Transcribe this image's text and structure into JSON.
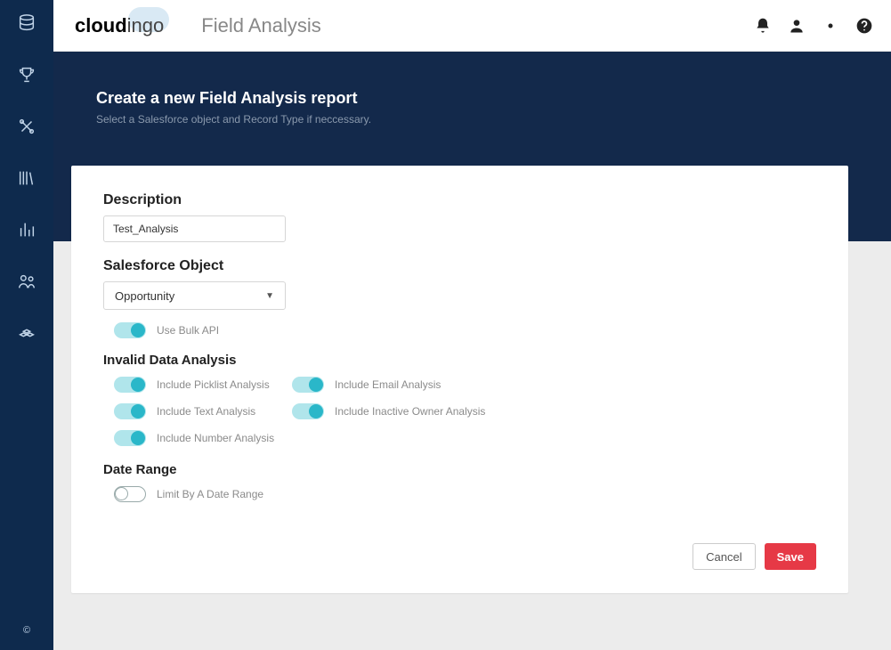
{
  "brand": {
    "part1": "cloud",
    "part2": "ingo"
  },
  "page_title": "Field Analysis",
  "copyright_symbol": "©",
  "hero": {
    "title": "Create a new Field Analysis report",
    "subtitle": "Select a Salesforce object and Record Type if neccessary."
  },
  "form": {
    "description_label": "Description",
    "description_value": "Test_Analysis",
    "object_label": "Salesforce Object",
    "object_value": "Opportunity",
    "bulk_api_label": "Use Bulk API",
    "invalid_label": "Invalid Data Analysis",
    "toggles": {
      "picklist": "Include Picklist Analysis",
      "email": "Include Email Analysis",
      "text": "Include Text Analysis",
      "owner": "Include Inactive Owner Analysis",
      "number": "Include Number Analysis"
    },
    "date_range_label": "Date Range",
    "limit_date_label": "Limit By A Date Range"
  },
  "buttons": {
    "cancel": "Cancel",
    "save": "Save"
  },
  "colors": {
    "save_bg": "#e63946",
    "toggle_on": "#2ab7c9"
  }
}
